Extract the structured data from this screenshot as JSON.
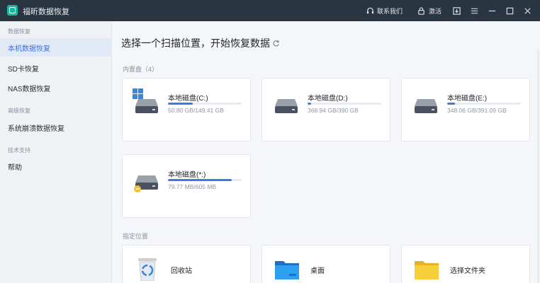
{
  "app": {
    "title": "福昕数据恢复"
  },
  "titlebar": {
    "contact_label": "联系我们",
    "activate_label": "激活"
  },
  "sidebar": {
    "groups": [
      {
        "label": "数据恢复"
      },
      {
        "label": "高级恢复"
      },
      {
        "label": "技术支持"
      }
    ],
    "items": [
      {
        "label": "本机数据恢复",
        "active": true
      },
      {
        "label": "SD卡恢复"
      },
      {
        "label": "NAS数据恢复"
      },
      {
        "label": "系统崩溃数据恢复"
      },
      {
        "label": "帮助"
      }
    ]
  },
  "main": {
    "title": "选择一个扫描位置，开始恢复数据",
    "internal_label": "内置盘（4）",
    "drives": [
      {
        "name": "本地磁盘(C:)",
        "size": "50.80 GB/149.41 GB",
        "usage": 0.34,
        "system": true
      },
      {
        "name": "本地磁盘(D:)",
        "size": "368.94 GB/390 GB",
        "usage": 0.05
      },
      {
        "name": "本地磁盘(E:)",
        "size": "348.06 GB/391.09 GB",
        "usage": 0.11
      },
      {
        "name": "本地磁盘(*:)",
        "size": "79.77 MB/605 MB",
        "usage": 0.87,
        "warning": true
      }
    ],
    "location_label": "指定位置",
    "locations": [
      {
        "name": "回收站",
        "icon": "recycle-bin-icon"
      },
      {
        "name": "桌面",
        "icon": "desktop-folder-icon"
      },
      {
        "name": "选择文件夹",
        "icon": "folder-icon"
      }
    ]
  },
  "colors": {
    "accent": "#3a7be0",
    "titlebar": "#2a3542",
    "sidebar_active": "#e1e8f6"
  }
}
